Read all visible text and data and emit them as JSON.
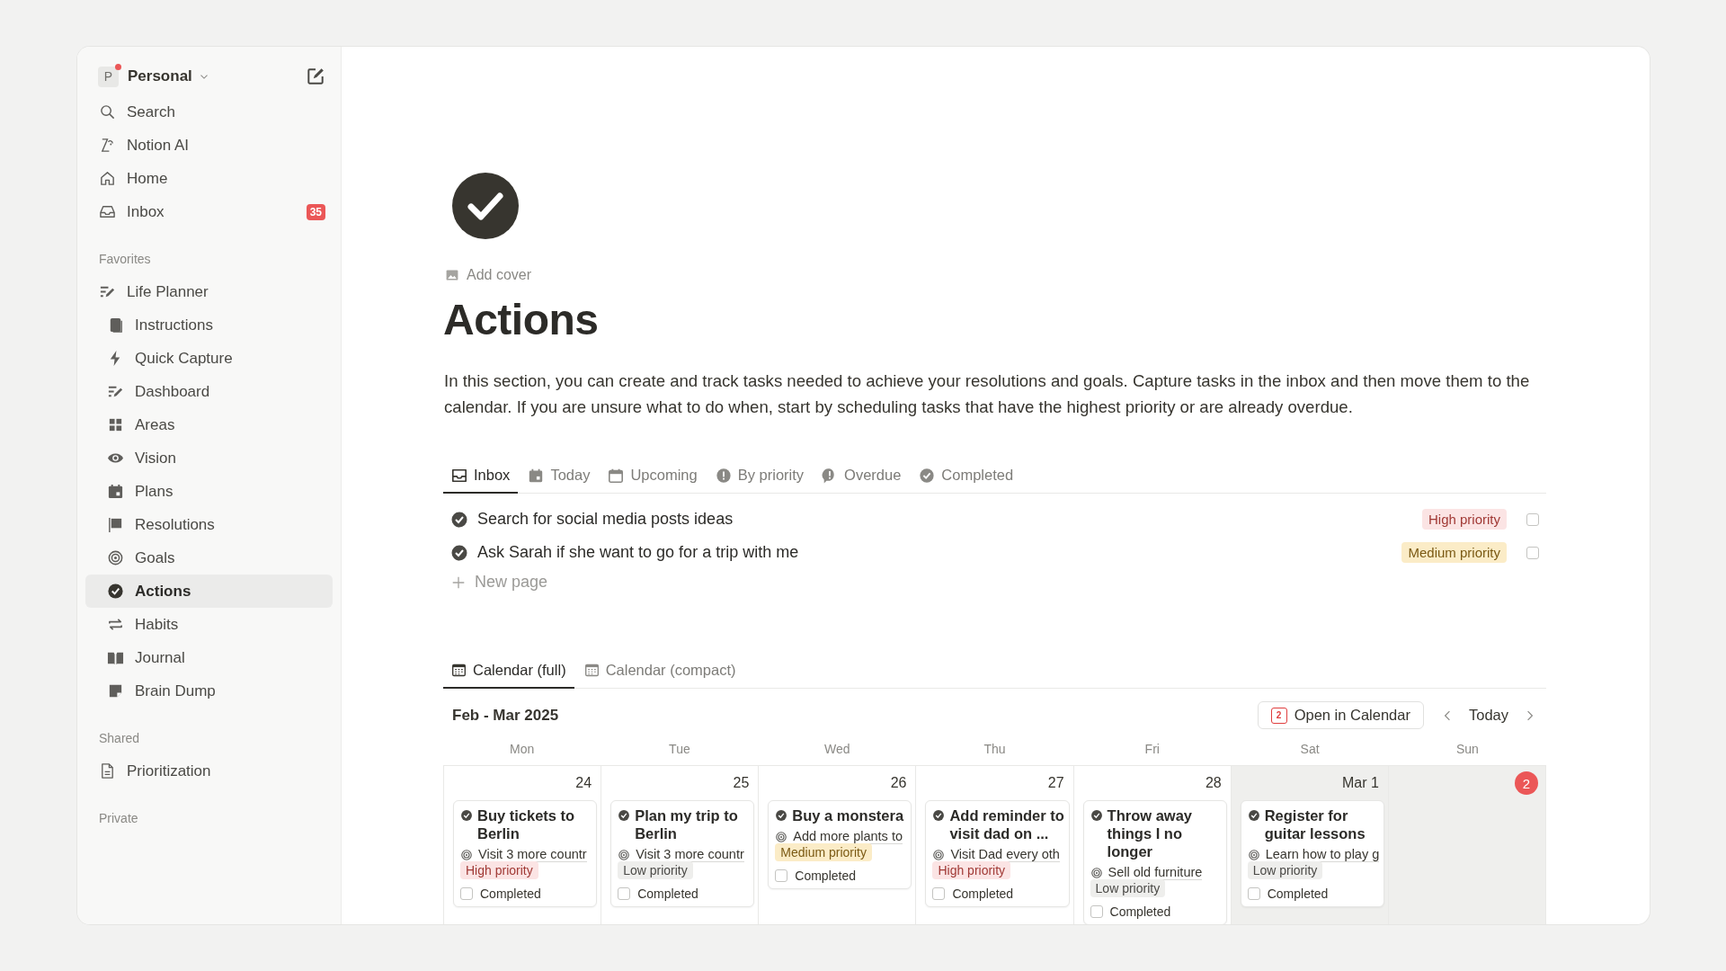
{
  "sidebar": {
    "workspace": {
      "initial": "P",
      "name": "Personal",
      "notification": true
    },
    "top_items": [
      {
        "label": "Search"
      },
      {
        "label": "Notion AI"
      },
      {
        "label": "Home"
      },
      {
        "label": "Inbox",
        "badge": "35"
      }
    ],
    "sections": [
      {
        "title": "Favorites",
        "items": [
          {
            "label": "Life Planner",
            "selected": false,
            "children": [
              {
                "label": "Instructions",
                "selected": false
              },
              {
                "label": "Quick Capture",
                "selected": false
              },
              {
                "label": "Dashboard",
                "selected": false
              },
              {
                "label": "Areas",
                "selected": false
              },
              {
                "label": "Vision",
                "selected": false
              },
              {
                "label": "Plans",
                "selected": false
              },
              {
                "label": "Resolutions",
                "selected": false
              },
              {
                "label": "Goals",
                "selected": false
              },
              {
                "label": "Actions",
                "selected": true
              },
              {
                "label": "Habits",
                "selected": false
              },
              {
                "label": "Journal",
                "selected": false
              },
              {
                "label": "Brain Dump",
                "selected": false
              }
            ]
          }
        ]
      },
      {
        "title": "Shared",
        "items": [
          {
            "label": "Prioritization",
            "selected": false
          }
        ]
      },
      {
        "title": "Private"
      }
    ]
  },
  "page": {
    "add_cover": "Add cover",
    "title": "Actions",
    "description": "In this section, you can create and track tasks needed to achieve your resolutions and goals. Capture tasks in the inbox and then move them to the calendar. If you are unsure what to do when, start by scheduling tasks that have the highest priority or are already overdue.",
    "views": [
      {
        "label": "Inbox",
        "selected": true
      },
      {
        "label": "Today",
        "selected": false
      },
      {
        "label": "Upcoming",
        "selected": false
      },
      {
        "label": "By priority",
        "selected": false
      },
      {
        "label": "Overdue",
        "selected": false
      },
      {
        "label": "Completed",
        "selected": false
      }
    ],
    "inbox_rows": [
      {
        "title": "Search for social media posts ideas",
        "priority": {
          "label": "High priority",
          "kind": "high"
        },
        "checked": false
      },
      {
        "title": "Ask Sarah if she want to go for a trip with me",
        "priority": {
          "label": "Medium priority",
          "kind": "medium"
        },
        "checked": false
      }
    ],
    "new_page": "New page",
    "calendar_views": [
      {
        "label": "Calendar (full)",
        "selected": true
      },
      {
        "label": "Calendar (compact)",
        "selected": false
      }
    ],
    "calendar": {
      "range": "Feb - Mar 2025",
      "open_button": {
        "label": "Open in Calendar",
        "icon_text": "2"
      },
      "today_button": "Today",
      "weekdays": [
        "Mon",
        "Tue",
        "Wed",
        "Thu",
        "Fri",
        "Sat",
        "Sun"
      ],
      "days": [
        {
          "date": "24",
          "today": false,
          "weekend": false,
          "events": [
            {
              "title": "Buy tickets to Berlin",
              "goal": "Visit 3 more countr",
              "priority": {
                "label": "High priority",
                "kind": "high"
              },
              "completed_label": "Completed",
              "completed": false
            }
          ]
        },
        {
          "date": "25",
          "today": false,
          "weekend": false,
          "events": [
            {
              "title": "Plan my trip to Berlin",
              "goal": "Visit 3 more countr",
              "priority": {
                "label": "Low priority",
                "kind": "low"
              },
              "completed_label": "Completed",
              "completed": false
            }
          ]
        },
        {
          "date": "26",
          "today": false,
          "weekend": false,
          "events": [
            {
              "title": "Buy a monstera",
              "goal": "Add more plants to",
              "priority": {
                "label": "Medium priority",
                "kind": "medium"
              },
              "completed_label": "Completed",
              "completed": false
            }
          ]
        },
        {
          "date": "27",
          "today": false,
          "weekend": false,
          "events": [
            {
              "title": "Add reminder to visit dad on ...",
              "goal": "Visit Dad every oth",
              "priority": {
                "label": "High priority",
                "kind": "high"
              },
              "completed_label": "Completed",
              "completed": false
            }
          ]
        },
        {
          "date": "28",
          "today": false,
          "weekend": false,
          "events": [
            {
              "title": "Throw away things I no longer",
              "goal": "Sell old furniture",
              "priority": {
                "label": "Low priority",
                "kind": "low"
              },
              "completed_label": "Completed",
              "completed": false
            }
          ]
        },
        {
          "date": "Mar 1",
          "today": false,
          "weekend": true,
          "events": [
            {
              "title": "Register for guitar lessons",
              "goal": "Learn how to play g",
              "priority": {
                "label": "Low priority",
                "kind": "low"
              },
              "completed_label": "Completed",
              "completed": false
            }
          ]
        },
        {
          "date": "2",
          "today": true,
          "weekend": true
        }
      ]
    }
  }
}
